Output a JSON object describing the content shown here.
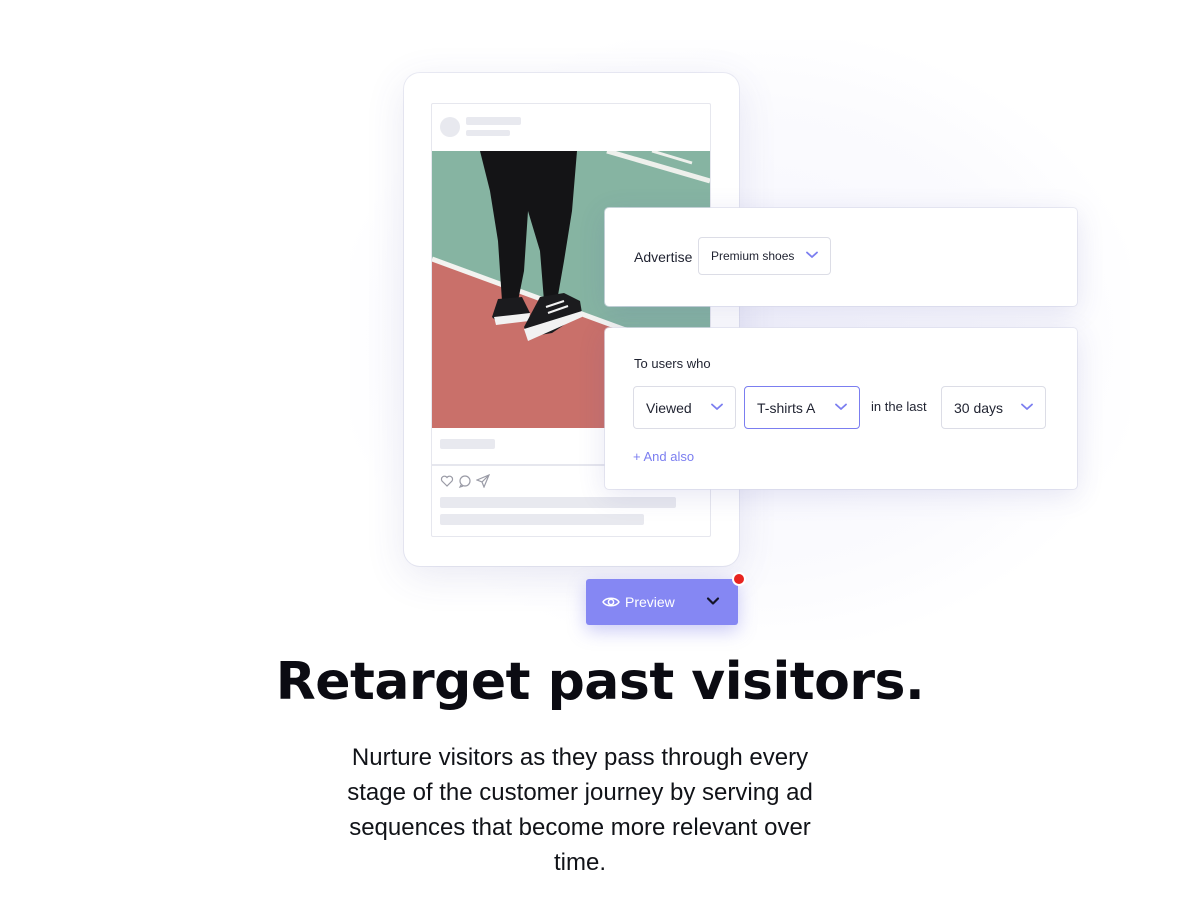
{
  "advertise_card": {
    "label": "Advertise",
    "product_select": {
      "value": "Premium shoes",
      "icon": "chevron-down-icon"
    }
  },
  "audience_card": {
    "label": "To users who",
    "action_select": {
      "value": "Viewed"
    },
    "item_select": {
      "value": "T-shirts A"
    },
    "period_label": "in the last",
    "period_select": {
      "value": "30 days"
    },
    "add_link": "+ And also"
  },
  "preview_button": {
    "label": "Preview",
    "icon": "eye-icon",
    "has_notification": true
  },
  "headline": "Retarget past visitors.",
  "body": "Nurture visitors as they pass through every stage of the customer journey by serving ad sequences that become more relevant over time.",
  "colors": {
    "accent": "#7b7ef0",
    "button": "#8587f3",
    "notification": "#e8231f"
  }
}
